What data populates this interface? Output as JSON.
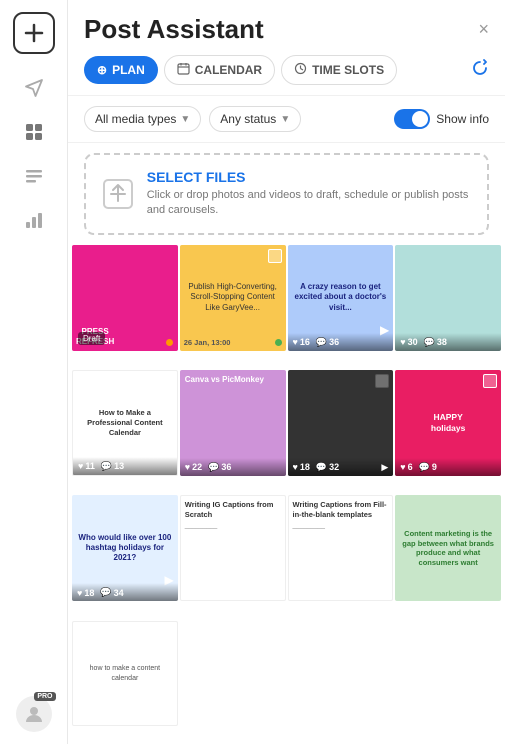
{
  "app": {
    "title": "Post Assistant",
    "close_label": "×"
  },
  "tabs": [
    {
      "id": "plan",
      "label": "PLAN",
      "icon": "⊕",
      "active": true
    },
    {
      "id": "calendar",
      "label": "CALENDAR",
      "icon": "📅",
      "active": false
    },
    {
      "id": "timeslots",
      "label": "TIME SLOTS",
      "icon": "⏱",
      "active": false
    }
  ],
  "filters": {
    "media_label": "All media types",
    "status_label": "Any status",
    "show_info_label": "Show info"
  },
  "upload": {
    "title": "SELECT FILES",
    "description": "Click or drop photos and videos to draft, schedule or publish posts and carousels."
  },
  "grid_items": [
    {
      "id": 1,
      "color": "color-pink",
      "text": "PRESS REFRESH",
      "has_draft": true,
      "likes": null,
      "comments": null,
      "status": "draft"
    },
    {
      "id": 2,
      "color": "color-yellow",
      "text": "Publish High-Converting, Scroll-Stopping Content Like GaryVee...",
      "has_draft": false,
      "likes": null,
      "comments": null,
      "date": "26 Jan, 13:00",
      "status": "scheduled"
    },
    {
      "id": 3,
      "color": "color-blue",
      "text": "A crazy reason to get excited about a doctor's visit...",
      "has_draft": false,
      "likes": 16,
      "comments": 36,
      "status": "published"
    },
    {
      "id": 4,
      "color": "color-teal",
      "text": "",
      "has_draft": false,
      "likes": 30,
      "comments": 38,
      "status": "published"
    },
    {
      "id": 5,
      "color": "color-white-bg",
      "text": "How to Make a Professional Content Calendar",
      "has_draft": false,
      "likes": 11,
      "comments": 13,
      "status": "published"
    },
    {
      "id": 6,
      "color": "color-purple",
      "text": "Canva vs PicMonkey",
      "has_draft": false,
      "likes": 22,
      "comments": 36,
      "status": "published"
    },
    {
      "id": 7,
      "color": "color-dark",
      "text": "",
      "has_draft": false,
      "likes": 18,
      "comments": 32,
      "status": "published"
    },
    {
      "id": 8,
      "color": "color-magenta",
      "text": "HAPPY holidays",
      "has_draft": false,
      "likes": 6,
      "comments": 9,
      "status": "published"
    },
    {
      "id": 9,
      "color": "color-blue",
      "text": "Who would like over 100 hashtag holidays for 2021?",
      "has_draft": false,
      "likes": 18,
      "comments": 34,
      "status": "published"
    },
    {
      "id": 10,
      "color": "color-text-bg",
      "text": "Writing IG Captions from Scratch",
      "has_draft": false,
      "likes": null,
      "comments": null,
      "status": "none"
    },
    {
      "id": 11,
      "color": "color-text-bg",
      "text": "Writing Captions from Fill-in-the-blank templates",
      "has_draft": false,
      "likes": null,
      "comments": null,
      "status": "none"
    },
    {
      "id": 12,
      "color": "color-green",
      "text": "Content marketing is the gap between...",
      "has_draft": false,
      "likes": null,
      "comments": null,
      "status": "none"
    },
    {
      "id": 13,
      "color": "color-white-bg",
      "text": "how to make a content calendar",
      "has_draft": false,
      "likes": null,
      "comments": null,
      "status": "none"
    }
  ],
  "sidebar": {
    "logo_icon": "✚",
    "icons": [
      {
        "id": "send",
        "symbol": "➤",
        "active": false
      },
      {
        "id": "media",
        "symbol": "🖼",
        "active": true
      },
      {
        "id": "list",
        "symbol": "📋",
        "active": false
      },
      {
        "id": "chart",
        "symbol": "📊",
        "active": false
      }
    ],
    "user": {
      "pro": "PRO"
    }
  },
  "colors": {
    "accent": "#1a73e8",
    "draft": "rgba(0,0,0,0.5)",
    "green_dot": "#4caf50"
  }
}
